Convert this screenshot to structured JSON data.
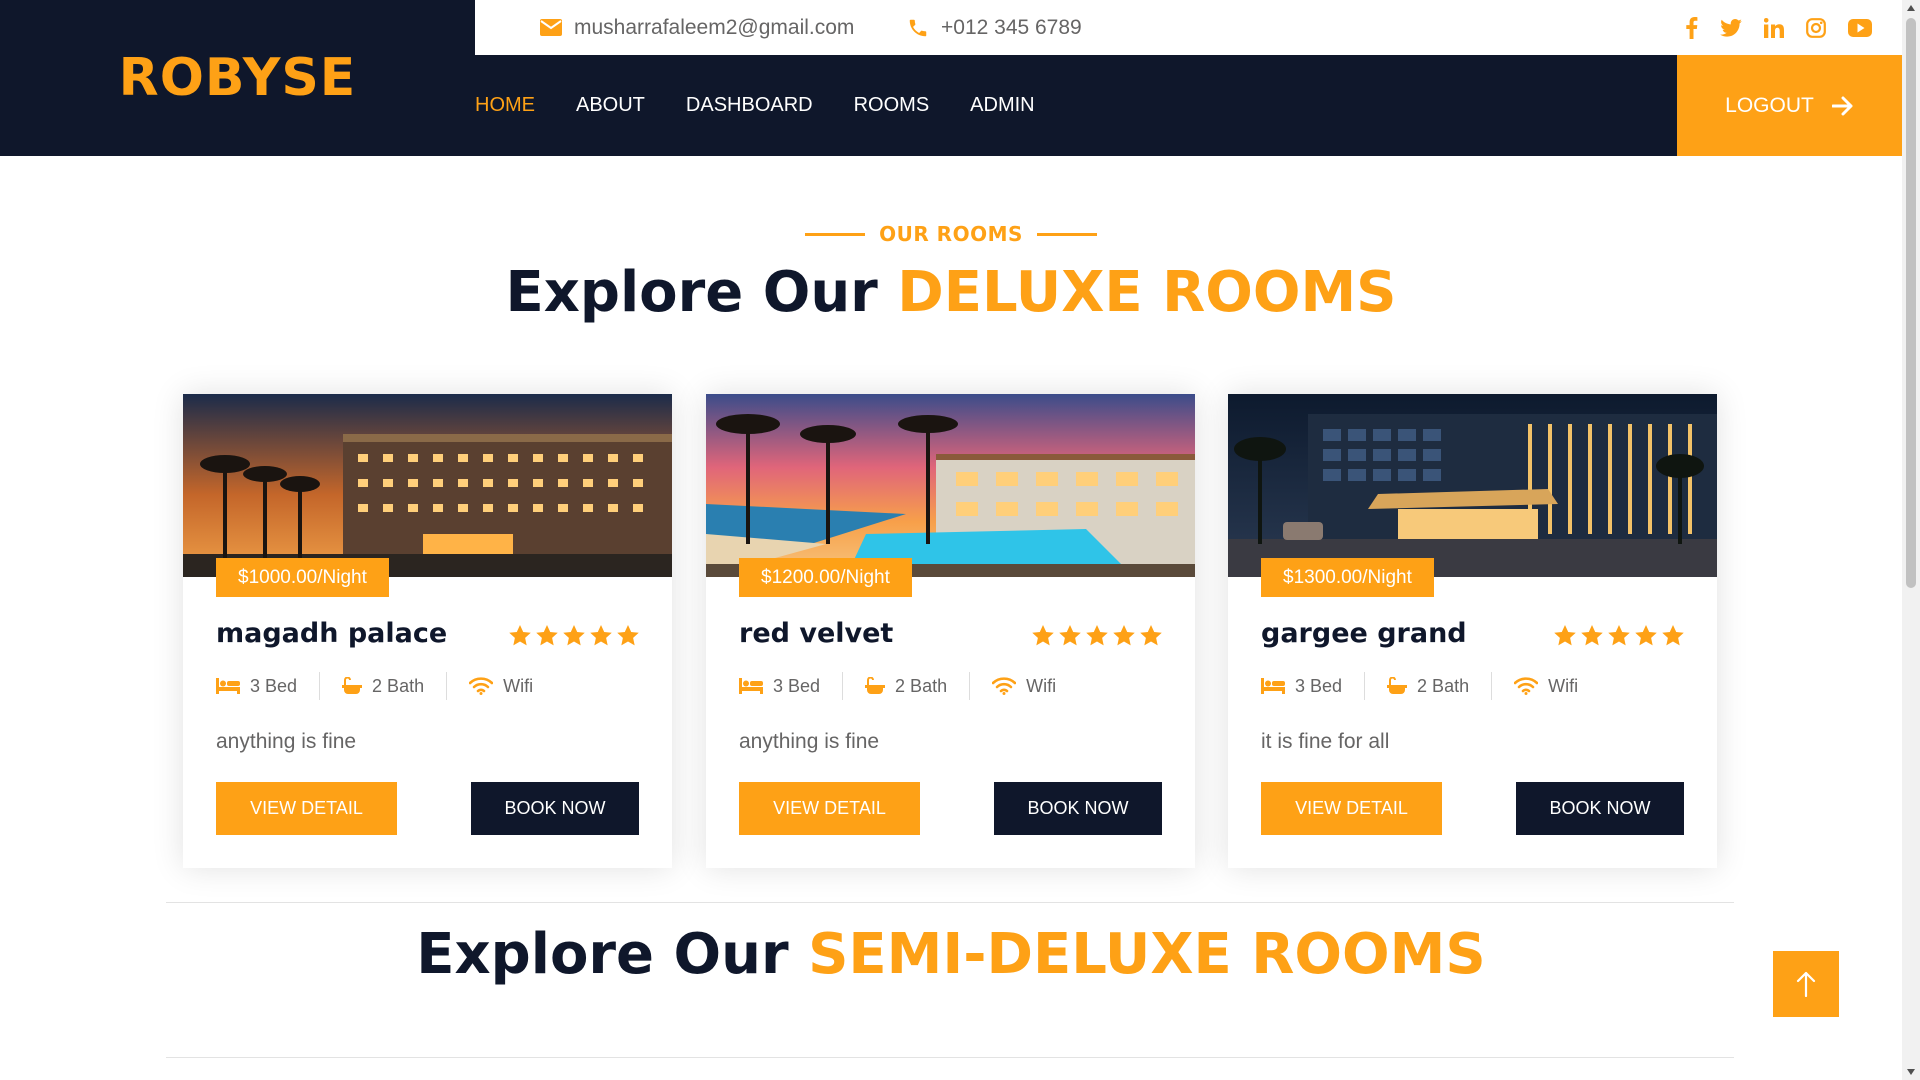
{
  "brand": "ROBYSE",
  "topbar": {
    "email": "musharrafaleem2@gmail.com",
    "phone": "+012 345 6789",
    "social": [
      "facebook-icon",
      "twitter-icon",
      "linkedin-icon",
      "instagram-icon",
      "youtube-icon"
    ]
  },
  "nav": {
    "items": [
      {
        "label": "HOME",
        "active": true
      },
      {
        "label": "ABOUT",
        "active": false
      },
      {
        "label": "DASHBOARD",
        "active": false
      },
      {
        "label": "ROOMS",
        "active": false
      },
      {
        "label": "ADMIN",
        "active": false
      }
    ],
    "logout": "LOGOUT"
  },
  "section": {
    "tag": "OUR ROOMS",
    "deluxe_prefix": "Explore Our ",
    "deluxe_highlight": "DELUXE ROOMS",
    "semi_prefix": "Explore Our ",
    "semi_highlight": "SEMI-DELUXE ROOMS"
  },
  "rooms": [
    {
      "price": "$1000.00/Night",
      "name": "magadh palace",
      "rating": 5,
      "bed": "3 Bed",
      "bath": "2 Bath",
      "wifi": "Wifi",
      "description": "anything is fine",
      "detail_label": "VIEW DETAIL",
      "book_label": "BOOK NOW"
    },
    {
      "price": "$1200.00/Night",
      "name": "red velvet",
      "rating": 5,
      "bed": "3 Bed",
      "bath": "2 Bath",
      "wifi": "Wifi",
      "description": "anything is fine",
      "detail_label": "VIEW DETAIL",
      "book_label": "BOOK NOW"
    },
    {
      "price": "$1300.00/Night",
      "name": "gargee grand",
      "rating": 5,
      "bed": "3 Bed",
      "bath": "2 Bath",
      "wifi": "Wifi",
      "description": "it is fine for all",
      "detail_label": "VIEW DETAIL",
      "book_label": "BOOK NOW"
    }
  ],
  "colors": {
    "primary": "#fea116",
    "dark": "#0f172b",
    "text": "#666565"
  }
}
